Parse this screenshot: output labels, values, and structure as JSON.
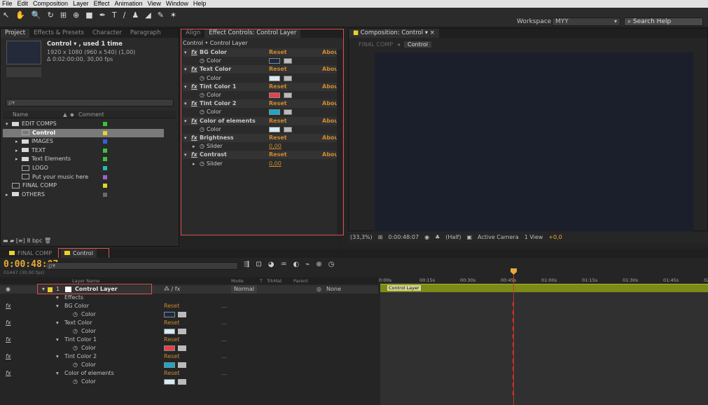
{
  "menu": [
    "File",
    "Edit",
    "Composition",
    "Layer",
    "Effect",
    "Animation",
    "View",
    "Window",
    "Help"
  ],
  "toolbar": {
    "workspace_label": "Workspace:",
    "workspace_value": "MYY",
    "search_placeholder": "Search Help"
  },
  "project": {
    "tabs": [
      "Project",
      "Effects & Presets",
      "Character",
      "Paragraph"
    ],
    "item_name": "Control ▾ , used 1 time",
    "item_res": "1920 x 1080  (960 x 540) (1,00)",
    "item_dur": "Δ 0:02:00:00, 30,00 fps",
    "search_placeholder": "ρ▾",
    "col_name": "Name",
    "col_comment": "Comment",
    "items": [
      {
        "label": "EDIT COMPS",
        "color": "#3cc43c",
        "type": "folder",
        "indent": 0
      },
      {
        "label": "Control",
        "color": "#e8d22a",
        "type": "comp",
        "indent": 1
      },
      {
        "label": "IMAGES",
        "color": "#3560e0",
        "type": "folder",
        "indent": 1
      },
      {
        "label": "TEXT",
        "color": "#3cc43c",
        "type": "folder",
        "indent": 1
      },
      {
        "label": "Text Elements",
        "color": "#3cc43c",
        "type": "folder",
        "indent": 1
      },
      {
        "label": "LOGO",
        "color": "#1ec0b0",
        "type": "comp",
        "indent": 1
      },
      {
        "label": "Put your music here",
        "color": "#a060c8",
        "type": "comp",
        "indent": 1
      },
      {
        "label": "FINAL COMP",
        "color": "#e8d22a",
        "type": "comp",
        "indent": 0
      },
      {
        "label": "OTHERS",
        "color": "#6a6a6a",
        "type": "folder",
        "indent": 0
      }
    ],
    "bpc": "8 bpc"
  },
  "effect_controls": {
    "tabs": [
      "Align",
      "Effect Controls: Control Layer"
    ],
    "title": "Control • Control Layer",
    "reset": "Reset",
    "about": "Abou",
    "rows": [
      {
        "kind": "fx",
        "label": "BG Color"
      },
      {
        "kind": "color",
        "label": "Color",
        "color": "#1a2a40"
      },
      {
        "kind": "fx",
        "label": "Text Color"
      },
      {
        "kind": "color",
        "label": "Color",
        "color": "#d8eaf4"
      },
      {
        "kind": "fx",
        "label": "Tint Color 1"
      },
      {
        "kind": "color",
        "label": "Color",
        "color": "#e8404a"
      },
      {
        "kind": "fx",
        "label": "Tint Color 2"
      },
      {
        "kind": "color",
        "label": "Color",
        "color": "#1aa8c8"
      },
      {
        "kind": "fx",
        "label": "Color of elements"
      },
      {
        "kind": "color",
        "label": "Color",
        "color": "#d8eaf4"
      },
      {
        "kind": "fx",
        "label": "Brightness"
      },
      {
        "kind": "slider",
        "label": "Slider",
        "value": "0,00"
      },
      {
        "kind": "fx",
        "label": "Contrast"
      },
      {
        "kind": "slider",
        "label": "Slider",
        "value": "0,00"
      }
    ]
  },
  "composition": {
    "tab": "Composition: Control",
    "breadcrumb_parent": "FINAL COMP",
    "breadcrumb_current": "Control",
    "zoom": "(33,3%)",
    "timecode": "0:00:48:07",
    "quality": "(Half)",
    "camera": "Active Camera",
    "view": "1 View",
    "exposure": "+0,0"
  },
  "timeline": {
    "tabs": [
      "FINAL COMP",
      "Control"
    ],
    "timecode": "0:00:48:07",
    "frames": "01447 (30.00 fps)",
    "search_placeholder": "ρ▾",
    "cols": {
      "layer_name": "Layer Name",
      "mode": "Mode",
      "t": "T",
      "trkmat": "TrkMat",
      "parent": "Parent"
    },
    "layer": {
      "index": "1",
      "name": "Control Layer",
      "mode": "Normal",
      "parent": "None"
    },
    "effects_label": "Effects",
    "effect_rows": [
      {
        "name": "BG Color",
        "color": "#1a2a40"
      },
      {
        "name": "Text Color",
        "color": "#d8eaf4"
      },
      {
        "name": "Tint Color 1",
        "color": "#e8404a"
      },
      {
        "name": "Tint Color 2",
        "color": "#1aa8c8"
      },
      {
        "name": "Color of elements",
        "color": "#d8eaf4"
      }
    ],
    "prop_label": "Color",
    "reset": "Reset",
    "ruler": [
      "0:00s",
      "00:15s",
      "00:30s",
      "00:45s",
      "01:00s",
      "01:15s",
      "01:30s",
      "01:45s",
      "02:"
    ],
    "bar_label": "Control Layer"
  },
  "colors": {
    "accent": "#e9a93b",
    "highlight_box": "#d9534f",
    "track": "#7b8a18"
  }
}
